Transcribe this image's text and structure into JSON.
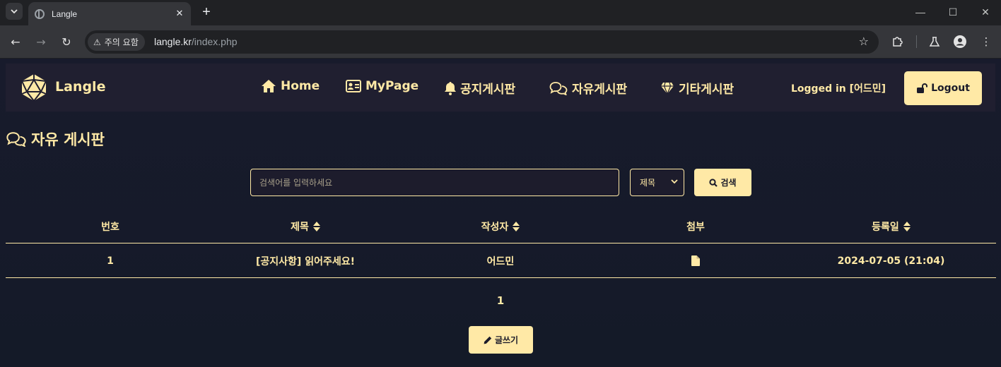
{
  "browser": {
    "tab_title": "Langle",
    "security_label": "주의 요함",
    "url_host": "langle.kr",
    "url_path": "/index.php"
  },
  "site": {
    "brand": "Langle",
    "nav": [
      {
        "label": "Home",
        "icon": "home-icon"
      },
      {
        "label": "MyPage",
        "icon": "id-card-icon"
      },
      {
        "label": "공지게시판",
        "icon": "bell-icon"
      },
      {
        "label": "자유게시판",
        "icon": "comments-icon"
      },
      {
        "label": "기타게시판",
        "icon": "gem-icon"
      }
    ],
    "logged_in": "Logged in [어드민]",
    "logout_label": "Logout"
  },
  "board": {
    "title": "자유 게시판",
    "search_placeholder": "검색어를 입력하세요",
    "search_field_selected": "제목",
    "search_button": "검색",
    "columns": [
      "번호",
      "제목",
      "작성자",
      "첨부",
      "등록일"
    ],
    "rows": [
      {
        "no": "1",
        "title": "[공지사항] 읽어주세요!",
        "author": "어드민",
        "attachment_icon": "file-icon",
        "date": "2024-07-05 (21:04)"
      }
    ],
    "page": "1",
    "write_button": "글쓰기"
  },
  "colors": {
    "accent": "#ffe9a6",
    "background": "#16192a",
    "navbar": "#201f30"
  }
}
